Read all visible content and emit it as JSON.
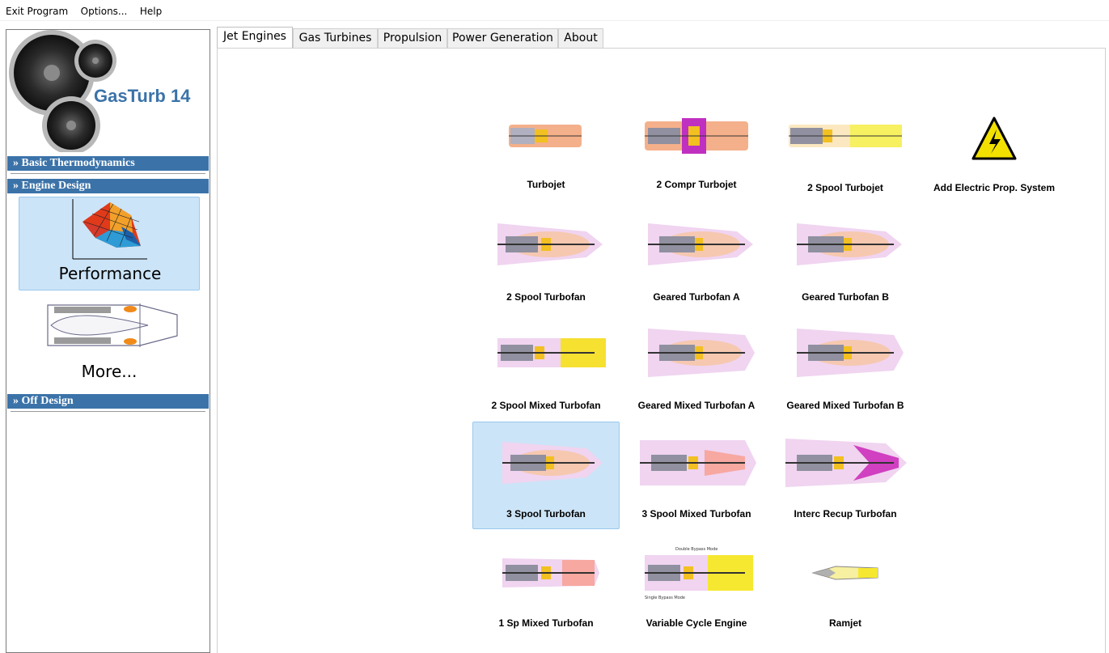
{
  "menu": {
    "exit": "Exit Program",
    "options": "Options...",
    "help": "Help"
  },
  "logo": {
    "text": "GasTurb 14"
  },
  "sidebar": {
    "basic": "» Basic Thermodynamics",
    "engine_design": "» Engine Design",
    "off_design": "» Off Design",
    "performance": "Performance",
    "more": "More..."
  },
  "tabs": [
    "Jet Engines",
    "Gas Turbines",
    "Propulsion",
    "Power Generation",
    "About"
  ],
  "engines": {
    "turbojet": "Turbojet",
    "compr2_turbojet": "2 Compr Turbojet",
    "spool2_turbojet": "2 Spool Turbojet",
    "electric": "Add Electric Prop. System",
    "spool2_turbofan": "2 Spool Turbofan",
    "geared_a": "Geared Turbofan A",
    "geared_b": "Geared Turbofan B",
    "spool2_mixed": "2 Spool Mixed Turbofan",
    "geared_mixed_a": "Geared Mixed Turbofan A",
    "geared_mixed_b": "Geared Mixed Turbofan B",
    "spool3_turbofan": "3 Spool Turbofan",
    "spool3_mixed": "3 Spool Mixed Turbofan",
    "interc_recup": "Interc Recup Turbofan",
    "sp1_mixed": "1 Sp Mixed Turbofan",
    "variable_cycle": "Variable Cycle Engine",
    "ramjet": "Ramjet",
    "vc_top_note": "Double Bypass Mode",
    "vc_bottom_note": "Single Bypass Mode"
  },
  "colors": {
    "accent": "#3b73a9",
    "selected_bg": "#cce4f7",
    "selected_border": "#99c9ef"
  }
}
